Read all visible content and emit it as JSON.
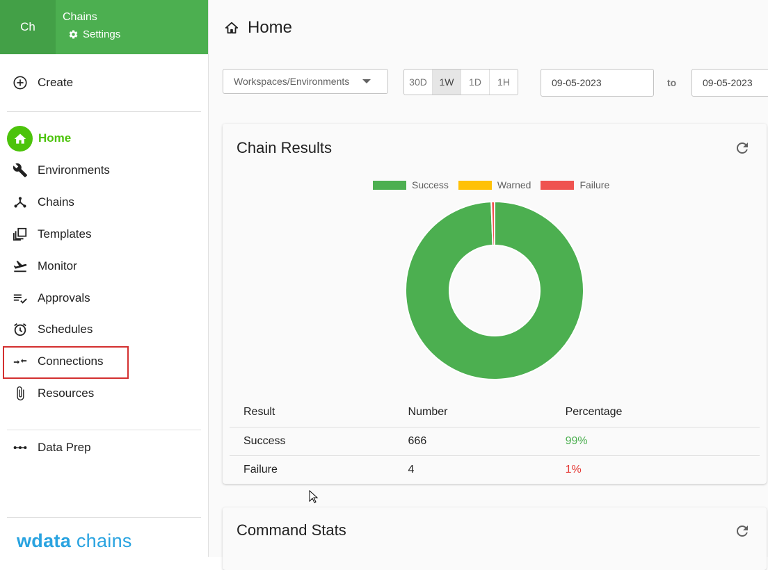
{
  "sidebar": {
    "avatar": "Ch",
    "app_title": "Chains",
    "settings_label": "Settings",
    "create_label": "Create",
    "items": [
      {
        "label": "Home",
        "icon": "home-icon",
        "active": true
      },
      {
        "label": "Environments",
        "icon": "wrench-icon"
      },
      {
        "label": "Chains",
        "icon": "chains-icon"
      },
      {
        "label": "Templates",
        "icon": "templates-icon"
      },
      {
        "label": "Monitor",
        "icon": "monitor-icon"
      },
      {
        "label": "Approvals",
        "icon": "approvals-icon"
      },
      {
        "label": "Schedules",
        "icon": "alarm-icon"
      },
      {
        "label": "Connections",
        "icon": "connections-icon"
      },
      {
        "label": "Resources",
        "icon": "paperclip-icon"
      }
    ],
    "data_prep_label": "Data Prep",
    "logo_bold": "wdata",
    "logo_light": " chains"
  },
  "header": {
    "title": "Home"
  },
  "filters": {
    "workspace_placeholder": "Workspaces/Environments",
    "ranges": [
      "30D",
      "1W",
      "1D",
      "1H"
    ],
    "selected_range": "1W",
    "date_from": "09-05-2023",
    "to_label": "to",
    "date_to": "09-05-2023"
  },
  "chain_results": {
    "title": "Chain Results",
    "legend": [
      {
        "label": "Success",
        "color": "#4caf50"
      },
      {
        "label": "Warned",
        "color": "#ffc107"
      },
      {
        "label": "Failure",
        "color": "#ef5350"
      }
    ],
    "columns": [
      "Result",
      "Number",
      "Percentage"
    ],
    "rows": [
      {
        "result": "Success",
        "number": "666",
        "percentage": "99%"
      },
      {
        "result": "Failure",
        "number": "4",
        "percentage": "1%"
      }
    ]
  },
  "chart_data": {
    "type": "pie",
    "donut": true,
    "categories": [
      "Success",
      "Warned",
      "Failure"
    ],
    "values": [
      666,
      0,
      4
    ],
    "colors": [
      "#4caf50",
      "#ffc107",
      "#ef5350"
    ],
    "legend": "top"
  },
  "command_stats": {
    "title": "Command Stats"
  }
}
